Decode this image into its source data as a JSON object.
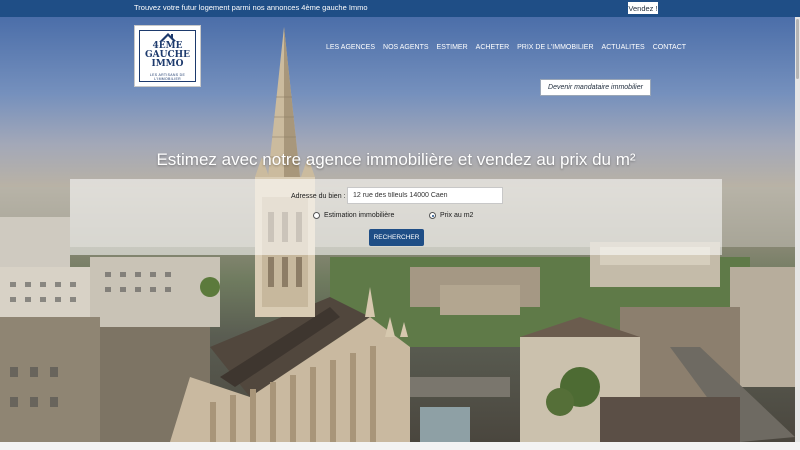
{
  "topbar": {
    "announcement": "Trouvez votre futur logement parmi nos annonces 4ème gauche Immo",
    "sell_label": "Vendez !"
  },
  "logo": {
    "line1": "4EME",
    "line2": "GAUCHE",
    "line3": "IMMO",
    "tagline": "LES ARTISANS DE L'IMMOBILIER"
  },
  "nav": {
    "items": [
      {
        "label": "LES AGENCES"
      },
      {
        "label": "NOS AGENTS"
      },
      {
        "label": "ESTIMER"
      },
      {
        "label": "ACHETER"
      },
      {
        "label": "PRIX DE L'IMMOBILIER"
      },
      {
        "label": "ACTUALITES"
      },
      {
        "label": "CONTACT"
      }
    ],
    "mandate_label": "Devenir mandataire immobilier"
  },
  "hero": {
    "headline": "Estimez avec notre agence immobilière et vendez au prix du m²"
  },
  "search": {
    "address_label": "Adresse du bien :",
    "address_value": "12 rue des tilleuls 14000 Caen",
    "options": [
      {
        "label": "Estimation immobilière",
        "selected": false
      },
      {
        "label": "Prix au m2",
        "selected": true
      }
    ],
    "submit_label": "RECHERCHER"
  },
  "colors": {
    "brand": "#1f4e86",
    "logo_navy": "#1d3a6d"
  }
}
